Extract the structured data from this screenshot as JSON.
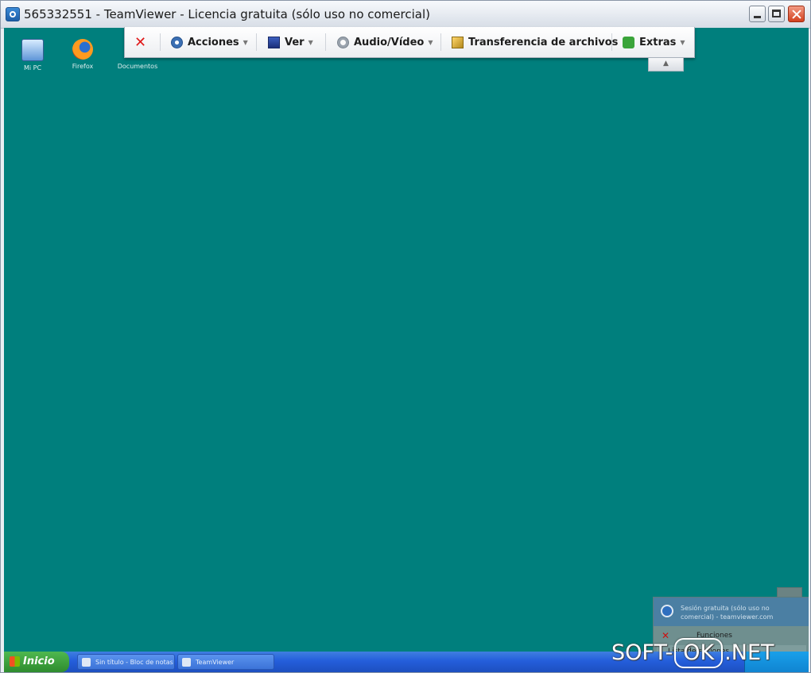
{
  "window": {
    "title": "565332551 - TeamViewer - Licencia gratuita (sólo uso no comercial)"
  },
  "toolbar": {
    "actions": "Acciones",
    "view": "Ver",
    "audio_video": "Audio/Vídeo",
    "file_transfer": "Transferencia de archivos",
    "extras": "Extras"
  },
  "desktop_icons": [
    {
      "label": "Mi PC",
      "icon": "computer-icon"
    },
    {
      "label": "Firefox",
      "icon": "firefox-icon"
    },
    {
      "label": "Documentos",
      "icon": "documents-icon"
    }
  ],
  "side_panel": {
    "header_text": "Sesión gratuita (sólo uso no comercial) - teamviewer.com",
    "functions": "Funciones",
    "session_list": "Lista de sesiones"
  },
  "taskbar": {
    "start": "Inicio",
    "tasks": [
      "Sin título - Bloc de notas",
      "TeamViewer"
    ]
  },
  "watermark": {
    "part1": "SOFT-",
    "part2": "OK",
    "part3": ".NET"
  },
  "colors": {
    "desktop": "#007f7d",
    "taskbar": "#245edb",
    "close_red": "#e01a1a"
  }
}
